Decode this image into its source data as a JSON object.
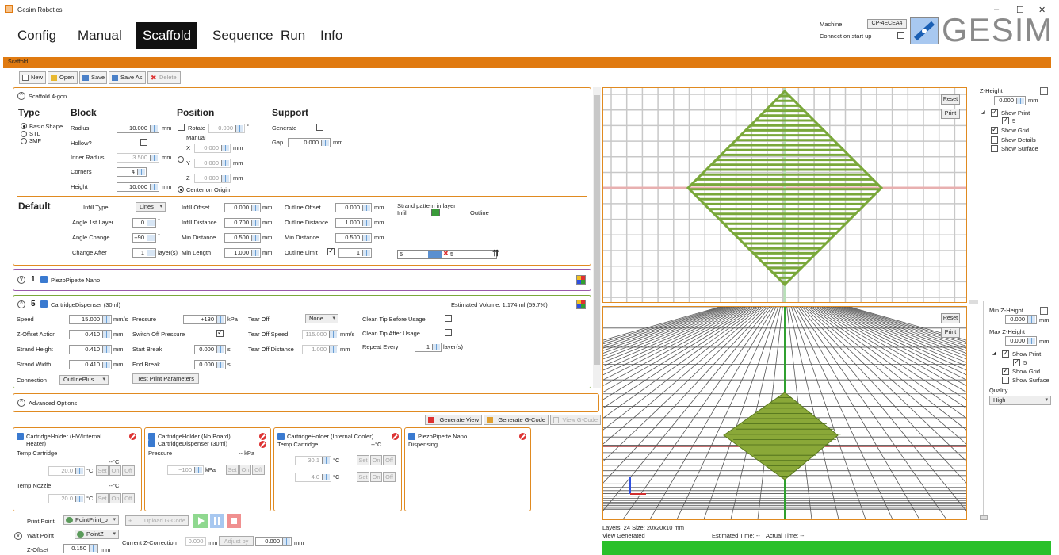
{
  "window": {
    "title": "Gesim Robotics",
    "min": "–",
    "max": "☐",
    "close": "✕"
  },
  "nav": {
    "tabs": [
      "Config",
      "Manual",
      "Scaffold",
      "Sequence",
      "Run",
      "Info"
    ]
  },
  "machine": {
    "label": "Machine",
    "value": "CP-4ECEA4",
    "connect_label": "Connect on start up",
    "logo": "GESIM"
  },
  "section_bar": "Scaffold",
  "toolbar": {
    "new": "New",
    "open": "Open",
    "save": "Save",
    "save_as": "Save As",
    "delete": "Delete"
  },
  "scaffold": {
    "header": "Scaffold 4-gon",
    "type": {
      "title": "Type",
      "options": [
        "Basic Shape",
        "STL",
        "3MF"
      ]
    },
    "block": {
      "title": "Block",
      "radius_label": "Radius",
      "radius": "10.000",
      "hollow_label": "Hollow?",
      "inner_radius_label": "Inner Radius",
      "inner_radius": "3.500",
      "corners_label": "Corners",
      "corners": "4",
      "height_label": "Height",
      "height": "10.000"
    },
    "position": {
      "title": "Position",
      "rotate_label": "Rotate",
      "rotate": "0.000",
      "manual_label": "Manual",
      "x_label": "X",
      "x": "0.000",
      "y_label": "Y",
      "y": "0.000",
      "z_label": "Z",
      "z": "0.000",
      "center_label": "Center on Origin"
    },
    "support": {
      "title": "Support",
      "generate_label": "Generate",
      "gap_label": "Gap",
      "gap": "0.000"
    },
    "default": {
      "title": "Default",
      "infill_type_label": "Infill Type",
      "infill_type": "Lines",
      "angle1_label": "Angle 1st Layer",
      "angle1": "0",
      "angle_change_label": "Angle Change",
      "angle_change": "+90",
      "change_after_label": "Change After",
      "change_after": "1",
      "layers_unit": "layer(s)",
      "infill_offset_label": "Infill Offset",
      "infill_offset": "0.000",
      "infill_distance_label": "Infill Distance",
      "infill_distance": "0.700",
      "min_distance_label": "Min Distance",
      "min_distance": "0.500",
      "min_length_label": "Min Length",
      "min_length": "1.000",
      "outline_offset_label": "Outline Offset",
      "outline_offset": "0.000",
      "outline_distance_label": "Outline Distance",
      "outline_distance": "1.000",
      "outline_min_distance_label": "Min Distance",
      "outline_min_distance": "0.500",
      "outline_limit_label": "Outline Limit",
      "outline_limit": "1",
      "strand_label": "Strand pattern in layer",
      "infill_label": "Infill",
      "outline_label": "Outline",
      "pattern_a": "5",
      "pattern_b": "5"
    }
  },
  "units": {
    "mm": "mm",
    "deg": "°",
    "kpa": "kPa",
    "mms": "mm/s",
    "s": "s",
    "degc": "°C"
  },
  "piezo": {
    "num": "1",
    "name": "PiezoPipette Nano"
  },
  "cartridge": {
    "num": "5",
    "name": "CartridgeDispenser (30ml)",
    "est_volume": "Estimated Volume: 1.174 ml (59.7%)",
    "speed_label": "Speed",
    "speed": "15.000",
    "zoffset_label": "Z-Offset Action",
    "zoffset": "0.410",
    "strand_height_label": "Strand Height",
    "strand_height": "0.410",
    "strand_width_label": "Strand Width",
    "strand_width": "0.410",
    "connection_label": "Connection",
    "connection": "OutlinePlus",
    "pressure_label": "Pressure",
    "pressure": "+130",
    "switch_off_label": "Switch Off Pressure",
    "start_break_label": "Start Break",
    "start_break": "0.000",
    "end_break_label": "End Break",
    "end_break": "0.000",
    "test_label": "Test Print Parameters",
    "tear_off_label": "Tear Off",
    "tear_off": "None",
    "tear_speed_label": "Tear Off Speed",
    "tear_speed": "115.000",
    "tear_dist_label": "Tear Off Distance",
    "tear_dist": "1.000",
    "clean_before_label": "Clean Tip Before Usage",
    "clean_after_label": "Clean Tip After Usage",
    "repeat_label": "Repeat Every",
    "repeat": "1",
    "repeat_unit": "layer(s)"
  },
  "advanced": "Advanced Options",
  "gen": {
    "view": "Generate View",
    "gcode": "Generate G-Code",
    "viewg": "View G-Code"
  },
  "holders": [
    {
      "title": "CartridgeHolder (HV/Internal Heater)",
      "l1": "Temp Cartridge",
      "v1": "--°C",
      "i1": "20.0",
      "l2": "Temp Nozzle",
      "v2": "--°C",
      "i2": "20.0"
    },
    {
      "title": "CartridgeHolder (No Board)",
      "title2": "CartridgeDispenser (30ml)",
      "l1": "Pressure",
      "v1": "-- kPa",
      "i1": "−100"
    },
    {
      "title": "CartridgeHolder (Internal Cooler)",
      "l1": "Temp Cartridge",
      "v1": "--°C",
      "i1": "30.1",
      "i2": "4.0"
    },
    {
      "title": "PiezoPipette Nano",
      "l1": "Dispensing"
    }
  ],
  "set_on_off": [
    "Set",
    "On",
    "Off"
  ],
  "bottom": {
    "print_point_label": "Print Point",
    "print_point": "PointPrint_b",
    "upload": "Upload G-Code",
    "wait_point_label": "Wait Point",
    "wait_point": "PointZ",
    "zcorr_label": "Current Z-Correction",
    "zcorr": "0.000",
    "adjust": "Adjust by",
    "adjust_val": "0.000",
    "zoffset_label": "Z-Offset",
    "zoffset": "0.150"
  },
  "view_top": {
    "reset": "Reset",
    "print": "Print",
    "zheight_label": "Z-Height",
    "zheight": "0.000",
    "show_print": "Show Print",
    "layer": "5",
    "show_grid": "Show Grid",
    "show_details": "Show Details",
    "show_surface": "Show Surface"
  },
  "view_bottom": {
    "reset": "Reset",
    "print": "Print",
    "min_z_label": "Min Z-Height",
    "min_z": "0.000",
    "max_z_label": "Max Z-Height",
    "max_z": "0.000",
    "show_print": "Show Print",
    "layer": "5",
    "show_grid": "Show Grid",
    "show_surface": "Show Surface",
    "quality_label": "Quality",
    "quality": "High"
  },
  "status": {
    "layers": "Layers: 24  Size: 20x20x10 mm",
    "view_generated": "View Generated",
    "est_time": "Estimated Time: --",
    "actual_time": "Actual Time: --"
  },
  "colors": {
    "accent": "#e07a10",
    "print_green": "#7aa83a",
    "status_green": "#2ac02a"
  }
}
